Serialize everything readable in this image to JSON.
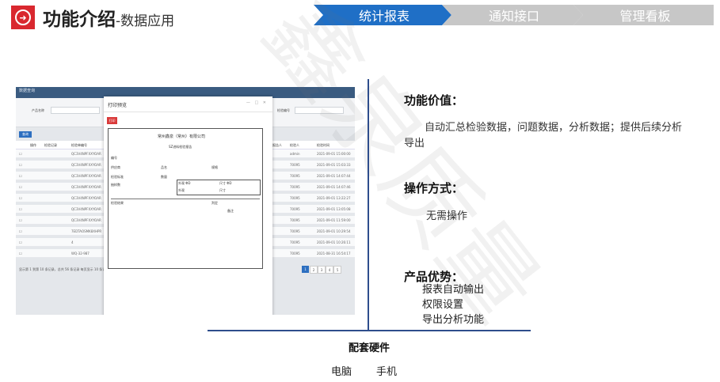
{
  "header": {
    "icon": "circle-arrow-right-icon",
    "accent_color": "#d9282f",
    "title": "功能介绍",
    "subtitle": "-数据应用"
  },
  "tabs": [
    {
      "label": "统计报表",
      "active": true
    },
    {
      "label": "通知接口",
      "active": false
    },
    {
      "label": "管理看板",
      "active": false
    }
  ],
  "tab_colors": {
    "active": "#1f6fc6",
    "inactive": "#c7c7c7"
  },
  "screenshot": {
    "app_bar": "数据查询",
    "filter_labels": [
      "产品名称",
      "检验编号"
    ],
    "query_button": "查询",
    "columns": [
      "操作",
      "检验记录",
      "检验单编号",
      "报告人",
      "检验人",
      "检验时间"
    ],
    "rows": [
      {
        "code": "QC3V4NPFXXYOAR",
        "user": "admin",
        "time": "2021-09-01 15:00:00"
      },
      {
        "code": "QC3V4NPFXXYOAR",
        "user": "70095",
        "time": "2021-09-01 15:03:33"
      },
      {
        "code": "QC3V4NPFXXYOAR",
        "user": "70095",
        "time": "2021-09-01 14:07:44"
      },
      {
        "code": "QC3V4NPFXXYOAR",
        "user": "70095",
        "time": "2021-09-01 14:07:46"
      },
      {
        "code": "QC3V4NPFXXYOAR",
        "user": "70095",
        "time": "2021-09-01 13:22:27"
      },
      {
        "code": "QC3V4NPFXXYOAR",
        "user": "70095",
        "time": "2021-09-01 13:05:08"
      },
      {
        "code": "QC3V4NPFXXYOAR",
        "user": "70095",
        "time": "2021-09-01 11:59:00"
      },
      {
        "code": "7EDTAOSMK8XHPR",
        "user": "70095",
        "time": "2021-09-01 10:29:54"
      },
      {
        "code": "4",
        "user": "70095",
        "time": "2021-09-01 10:26:11"
      },
      {
        "code": "WQ-32-987",
        "user": "70095",
        "time": "2021-08-31 16:54:17"
      }
    ],
    "pager_text": "显示第 1 到第 10 条记录，总共 56 条记录 每页显示 10 条记录",
    "pages": [
      "1",
      "2",
      "3",
      "4",
      "5"
    ],
    "modal": {
      "title": "打印预览",
      "print_button": "打印",
      "company": "常州鑫泉（常州）有限公司",
      "report_title": "SZ进料检验报告",
      "fields": [
        "编号",
        "供应商",
        "品名",
        "规格",
        "检验标准",
        "数量",
        "抽样数",
        "外观",
        "尺寸",
        "检验结果",
        "判定",
        "备注"
      ],
      "measure_labels": [
        "外观 ΦD",
        "尺寸 ΦD"
      ]
    }
  },
  "section_value": {
    "heading": "功能价值：",
    "text": "自动汇总检验数据，问题数据，分析数据；提供后续分析导出"
  },
  "section_operation": {
    "heading": "操作方式：",
    "text": "无需操作"
  },
  "section_advantage": {
    "heading": "产品优势：",
    "items": [
      "报表自动输出",
      "权限设置",
      "导出分析功能"
    ]
  },
  "hardware": {
    "heading": "配套硬件",
    "items": [
      "电脑",
      "手机"
    ]
  },
  "divider_color": "#2e4d8c"
}
